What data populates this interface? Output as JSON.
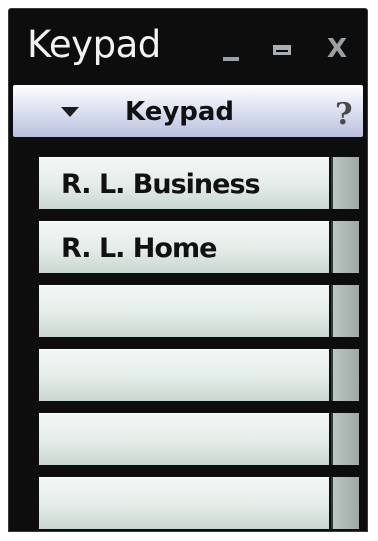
{
  "window": {
    "title": "Keypad"
  },
  "titlebar": {
    "minimize_icon": "minimize-icon",
    "maximize_icon": "maximize-icon",
    "close_glyph": "X"
  },
  "header": {
    "title": "Keypad",
    "help_glyph": "?"
  },
  "entries": [
    {
      "label": "R. L. Business"
    },
    {
      "label": "R. L. Home"
    },
    {
      "label": ""
    },
    {
      "label": ""
    },
    {
      "label": ""
    },
    {
      "label": ""
    }
  ],
  "colors": {
    "window_bg": "#0d0d0d",
    "header_bg": "#dfe3f2",
    "row_bg": "#e3ece8"
  }
}
